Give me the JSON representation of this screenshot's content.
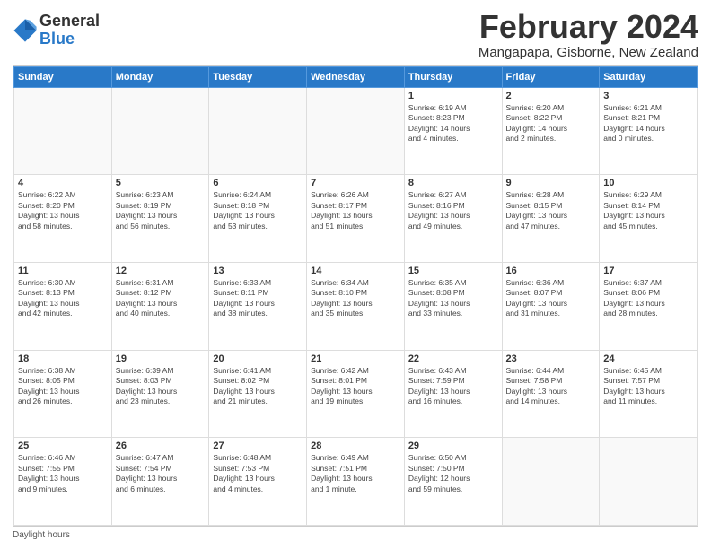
{
  "logo": {
    "general": "General",
    "blue": "Blue"
  },
  "title": "February 2024",
  "subtitle": "Mangapapa, Gisborne, New Zealand",
  "days_of_week": [
    "Sunday",
    "Monday",
    "Tuesday",
    "Wednesday",
    "Thursday",
    "Friday",
    "Saturday"
  ],
  "footer": {
    "label": "Daylight hours"
  },
  "weeks": [
    [
      {
        "day": "",
        "info": ""
      },
      {
        "day": "",
        "info": ""
      },
      {
        "day": "",
        "info": ""
      },
      {
        "day": "",
        "info": ""
      },
      {
        "day": "1",
        "info": "Sunrise: 6:19 AM\nSunset: 8:23 PM\nDaylight: 14 hours\nand 4 minutes."
      },
      {
        "day": "2",
        "info": "Sunrise: 6:20 AM\nSunset: 8:22 PM\nDaylight: 14 hours\nand 2 minutes."
      },
      {
        "day": "3",
        "info": "Sunrise: 6:21 AM\nSunset: 8:21 PM\nDaylight: 14 hours\nand 0 minutes."
      }
    ],
    [
      {
        "day": "4",
        "info": "Sunrise: 6:22 AM\nSunset: 8:20 PM\nDaylight: 13 hours\nand 58 minutes."
      },
      {
        "day": "5",
        "info": "Sunrise: 6:23 AM\nSunset: 8:19 PM\nDaylight: 13 hours\nand 56 minutes."
      },
      {
        "day": "6",
        "info": "Sunrise: 6:24 AM\nSunset: 8:18 PM\nDaylight: 13 hours\nand 53 minutes."
      },
      {
        "day": "7",
        "info": "Sunrise: 6:26 AM\nSunset: 8:17 PM\nDaylight: 13 hours\nand 51 minutes."
      },
      {
        "day": "8",
        "info": "Sunrise: 6:27 AM\nSunset: 8:16 PM\nDaylight: 13 hours\nand 49 minutes."
      },
      {
        "day": "9",
        "info": "Sunrise: 6:28 AM\nSunset: 8:15 PM\nDaylight: 13 hours\nand 47 minutes."
      },
      {
        "day": "10",
        "info": "Sunrise: 6:29 AM\nSunset: 8:14 PM\nDaylight: 13 hours\nand 45 minutes."
      }
    ],
    [
      {
        "day": "11",
        "info": "Sunrise: 6:30 AM\nSunset: 8:13 PM\nDaylight: 13 hours\nand 42 minutes."
      },
      {
        "day": "12",
        "info": "Sunrise: 6:31 AM\nSunset: 8:12 PM\nDaylight: 13 hours\nand 40 minutes."
      },
      {
        "day": "13",
        "info": "Sunrise: 6:33 AM\nSunset: 8:11 PM\nDaylight: 13 hours\nand 38 minutes."
      },
      {
        "day": "14",
        "info": "Sunrise: 6:34 AM\nSunset: 8:10 PM\nDaylight: 13 hours\nand 35 minutes."
      },
      {
        "day": "15",
        "info": "Sunrise: 6:35 AM\nSunset: 8:08 PM\nDaylight: 13 hours\nand 33 minutes."
      },
      {
        "day": "16",
        "info": "Sunrise: 6:36 AM\nSunset: 8:07 PM\nDaylight: 13 hours\nand 31 minutes."
      },
      {
        "day": "17",
        "info": "Sunrise: 6:37 AM\nSunset: 8:06 PM\nDaylight: 13 hours\nand 28 minutes."
      }
    ],
    [
      {
        "day": "18",
        "info": "Sunrise: 6:38 AM\nSunset: 8:05 PM\nDaylight: 13 hours\nand 26 minutes."
      },
      {
        "day": "19",
        "info": "Sunrise: 6:39 AM\nSunset: 8:03 PM\nDaylight: 13 hours\nand 23 minutes."
      },
      {
        "day": "20",
        "info": "Sunrise: 6:41 AM\nSunset: 8:02 PM\nDaylight: 13 hours\nand 21 minutes."
      },
      {
        "day": "21",
        "info": "Sunrise: 6:42 AM\nSunset: 8:01 PM\nDaylight: 13 hours\nand 19 minutes."
      },
      {
        "day": "22",
        "info": "Sunrise: 6:43 AM\nSunset: 7:59 PM\nDaylight: 13 hours\nand 16 minutes."
      },
      {
        "day": "23",
        "info": "Sunrise: 6:44 AM\nSunset: 7:58 PM\nDaylight: 13 hours\nand 14 minutes."
      },
      {
        "day": "24",
        "info": "Sunrise: 6:45 AM\nSunset: 7:57 PM\nDaylight: 13 hours\nand 11 minutes."
      }
    ],
    [
      {
        "day": "25",
        "info": "Sunrise: 6:46 AM\nSunset: 7:55 PM\nDaylight: 13 hours\nand 9 minutes."
      },
      {
        "day": "26",
        "info": "Sunrise: 6:47 AM\nSunset: 7:54 PM\nDaylight: 13 hours\nand 6 minutes."
      },
      {
        "day": "27",
        "info": "Sunrise: 6:48 AM\nSunset: 7:53 PM\nDaylight: 13 hours\nand 4 minutes."
      },
      {
        "day": "28",
        "info": "Sunrise: 6:49 AM\nSunset: 7:51 PM\nDaylight: 13 hours\nand 1 minute."
      },
      {
        "day": "29",
        "info": "Sunrise: 6:50 AM\nSunset: 7:50 PM\nDaylight: 12 hours\nand 59 minutes."
      },
      {
        "day": "",
        "info": ""
      },
      {
        "day": "",
        "info": ""
      }
    ]
  ]
}
